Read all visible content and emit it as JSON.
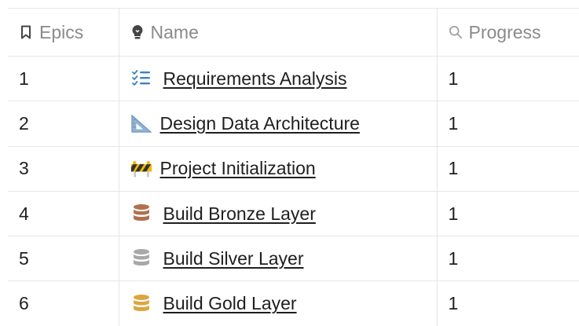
{
  "header": {
    "epics_label": "Epics",
    "name_label": "Name",
    "progress_label": "Progress",
    "epics_icon": "bookmark-icon",
    "name_icon": "lightbulb-icon",
    "progress_icon": "search-icon"
  },
  "rows": [
    {
      "epic": "1",
      "name": "Requirements Analysis",
      "icon": "checklist-icon",
      "progress": "1"
    },
    {
      "epic": "2",
      "name": "Design Data Architecture",
      "icon": "triangular-ruler-icon",
      "progress": "1"
    },
    {
      "epic": "3",
      "name": "Project Initialization",
      "icon": "construction-barrier-icon",
      "progress": "1"
    },
    {
      "epic": "4",
      "name": "Build Bronze Layer",
      "icon": "database-icon",
      "progress": "1",
      "icon_color": "#b0714f"
    },
    {
      "epic": "5",
      "name": "Build Silver Layer",
      "icon": "database-icon",
      "progress": "1",
      "icon_color": "#a8a8a8"
    },
    {
      "epic": "6",
      "name": "Build Gold Layer",
      "icon": "database-icon",
      "progress": "1",
      "icon_color": "#dba640"
    }
  ]
}
